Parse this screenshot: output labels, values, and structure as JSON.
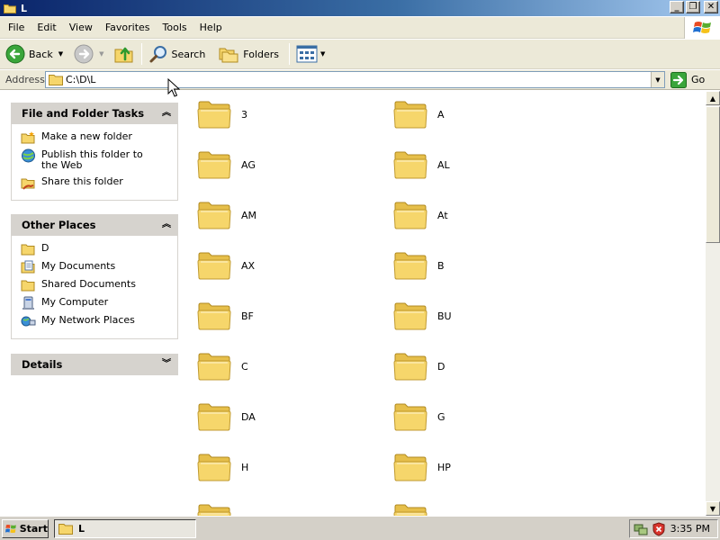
{
  "window": {
    "title": "L",
    "controls": {
      "minimize": "_",
      "maximize": "❐",
      "close": "✕"
    }
  },
  "menubar": {
    "items": [
      "File",
      "Edit",
      "View",
      "Favorites",
      "Tools",
      "Help"
    ],
    "logo_icon": "windows-flag-icon"
  },
  "toolbar": {
    "back_label": "Back",
    "forward_icon": "forward-arrow-icon",
    "up_icon": "up-folder-icon",
    "search_label": "Search",
    "folders_label": "Folders",
    "views_icon": "views-icon"
  },
  "address": {
    "label": "Address",
    "value": "C:\\D\\L",
    "go_label": "Go"
  },
  "tasks_panel": {
    "title": "File and Folder Tasks",
    "collapse_icon": "chevron-up-icon",
    "items": [
      {
        "label": "Make a new folder",
        "icon": "new-folder-icon"
      },
      {
        "label": "Publish this folder to the Web",
        "icon": "publish-web-icon"
      },
      {
        "label": "Share this folder",
        "icon": "share-folder-icon"
      }
    ]
  },
  "places_panel": {
    "title": "Other Places",
    "collapse_icon": "chevron-up-icon",
    "items": [
      {
        "label": "D",
        "icon": "folder-icon"
      },
      {
        "label": "My Documents",
        "icon": "my-documents-icon"
      },
      {
        "label": "Shared Documents",
        "icon": "folder-icon"
      },
      {
        "label": "My Computer",
        "icon": "my-computer-icon"
      },
      {
        "label": "My Network Places",
        "icon": "network-places-icon"
      }
    ]
  },
  "details_panel": {
    "title": "Details",
    "expand_icon": "chevron-down-icon"
  },
  "folders": [
    "3",
    "A",
    "AG",
    "AL",
    "AM",
    "At",
    "AX",
    "B",
    "BF",
    "BU",
    "C",
    "D",
    "DA",
    "G",
    "H",
    "HP",
    "",
    ""
  ],
  "taskbar": {
    "start_label": "Start",
    "task_label": "L",
    "clock": "3:35 PM"
  },
  "colors": {
    "title_gradient_start": "#0a246a",
    "title_gradient_end": "#a6caf0",
    "chrome": "#ece9d8",
    "panel_header": "#d6d3ce",
    "folder_yellow": "#f6d66b"
  }
}
